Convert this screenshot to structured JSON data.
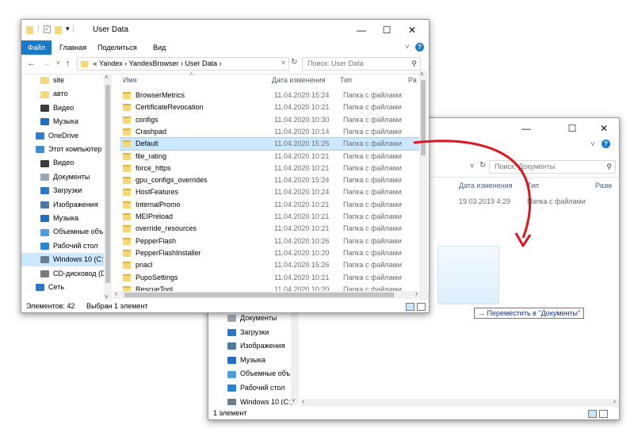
{
  "front_window": {
    "title": "User Data",
    "ribbon_tabs": [
      "Файл",
      "Главная",
      "Поделиться",
      "Вид"
    ],
    "address_path": [
      "«",
      "Yandex",
      "›",
      "YandexBrowser",
      "›",
      "User Data",
      "›"
    ],
    "search_placeholder": "Поиск: User Data",
    "nav_items": [
      {
        "label": "site",
        "icon": "folder-icon"
      },
      {
        "label": "авто",
        "icon": "folder-icon"
      },
      {
        "label": "Видео",
        "icon": "video-icon"
      },
      {
        "label": "Музыка",
        "icon": "music-icon"
      },
      {
        "label": "OneDrive",
        "icon": "onedrive-icon"
      },
      {
        "label": "Этот компьютер",
        "icon": "computer-icon"
      },
      {
        "label": "Видео",
        "icon": "video-icon"
      },
      {
        "label": "Документы",
        "icon": "documents-icon"
      },
      {
        "label": "Загрузки",
        "icon": "downloads-icon"
      },
      {
        "label": "Изображения",
        "icon": "pictures-icon"
      },
      {
        "label": "Музыка",
        "icon": "music-icon"
      },
      {
        "label": "Объемные объ",
        "icon": "3d-objects-icon"
      },
      {
        "label": "Рабочий стол",
        "icon": "desktop-icon"
      },
      {
        "label": "Windows 10 (C:)",
        "icon": "drive-icon",
        "selected": true
      },
      {
        "label": "CD-дисковод (D",
        "icon": "cd-drive-icon"
      },
      {
        "label": "Сеть",
        "icon": "network-icon"
      }
    ],
    "columns": {
      "name": "Имя",
      "date": "Дата изменения",
      "type": "Тип",
      "size": "Ра"
    },
    "files": [
      {
        "name": "BrowserMetrics",
        "date": "11.04.2020 15:24",
        "type": "Папка с файлами"
      },
      {
        "name": "CertificateRevocation",
        "date": "11.04.2020 10:21",
        "type": "Папка с файлами"
      },
      {
        "name": "configs",
        "date": "11.04.2020 10:30",
        "type": "Папка с файлами"
      },
      {
        "name": "Crashpad",
        "date": "11.04.2020 10:14",
        "type": "Папка с файлами"
      },
      {
        "name": "Default",
        "date": "11.04.2020 15:25",
        "type": "Папка с файлами",
        "selected": true
      },
      {
        "name": "file_rating",
        "date": "11.04.2020 10:21",
        "type": "Папка с файлами"
      },
      {
        "name": "force_https",
        "date": "11.04.2020 10:21",
        "type": "Папка с файлами"
      },
      {
        "name": "gpu_configs_overrides",
        "date": "11.04.2020 15:24",
        "type": "Папка с файлами"
      },
      {
        "name": "HostFeatures",
        "date": "11.04.2020 10:24",
        "type": "Папка с файлами"
      },
      {
        "name": "InternalPromo",
        "date": "11.04.2020 10:21",
        "type": "Папка с файлами"
      },
      {
        "name": "MEIPreload",
        "date": "11.04.2020 10:21",
        "type": "Папка с файлами"
      },
      {
        "name": "override_resources",
        "date": "11.04.2020 10:21",
        "type": "Папка с файлами"
      },
      {
        "name": "PepperFlash",
        "date": "11.04.2020 10:26",
        "type": "Папка с файлами"
      },
      {
        "name": "PepperFlashInstaller",
        "date": "11.04.2020 10:20",
        "type": "Папка с файлами"
      },
      {
        "name": "pnacl",
        "date": "11.04.2020 15:26",
        "type": "Папка с файлами"
      },
      {
        "name": "PupoSettings",
        "date": "11.04.2020 10:21",
        "type": "Папка с файлами"
      },
      {
        "name": "RescueTool",
        "date": "11.04.2020 10:20",
        "type": "Папка с файлами"
      }
    ],
    "status_count": "Элементов: 42",
    "status_selected": "Выбран 1 элемент"
  },
  "back_window": {
    "search_placeholder": "Поиск: Документы",
    "columns": {
      "date": "Дата изменения",
      "type": "Тип",
      "size": "Разм"
    },
    "row": {
      "date": "19.03.2019 4:29",
      "type": "Папка с файлами"
    },
    "nav_items": [
      {
        "label": "Документы",
        "icon": "documents-icon"
      },
      {
        "label": "Загрузки",
        "icon": "downloads-icon"
      },
      {
        "label": "Изображения",
        "icon": "pictures-icon"
      },
      {
        "label": "Музыка",
        "icon": "music-icon"
      },
      {
        "label": "Объемные объ",
        "icon": "3d-objects-icon"
      },
      {
        "label": "Рабочий стол",
        "icon": "desktop-icon"
      },
      {
        "label": "Windows 10 (C:)",
        "icon": "drive-icon"
      }
    ],
    "status": "1 элемент"
  },
  "drag_tooltip": "→ Переместить в \"Документы\"",
  "colors": {
    "accent": "#1979ca",
    "selection": "#cce8ff",
    "arrow": "#e0141e",
    "folder": "#f8d775"
  }
}
